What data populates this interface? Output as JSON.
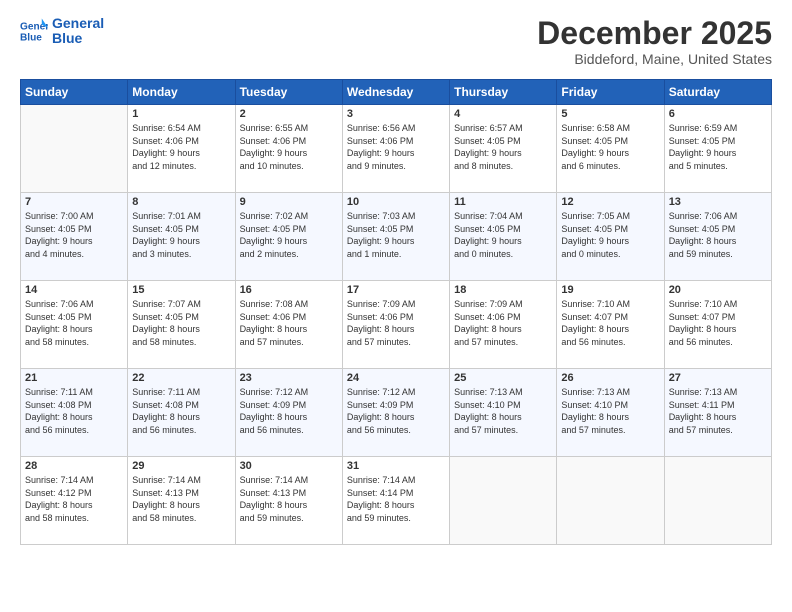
{
  "logo": {
    "line1": "General",
    "line2": "Blue"
  },
  "title": "December 2025",
  "subtitle": "Biddeford, Maine, United States",
  "days_header": [
    "Sunday",
    "Monday",
    "Tuesday",
    "Wednesday",
    "Thursday",
    "Friday",
    "Saturday"
  ],
  "weeks": [
    [
      {
        "day": "",
        "info": ""
      },
      {
        "day": "1",
        "info": "Sunrise: 6:54 AM\nSunset: 4:06 PM\nDaylight: 9 hours\nand 12 minutes."
      },
      {
        "day": "2",
        "info": "Sunrise: 6:55 AM\nSunset: 4:06 PM\nDaylight: 9 hours\nand 10 minutes."
      },
      {
        "day": "3",
        "info": "Sunrise: 6:56 AM\nSunset: 4:06 PM\nDaylight: 9 hours\nand 9 minutes."
      },
      {
        "day": "4",
        "info": "Sunrise: 6:57 AM\nSunset: 4:05 PM\nDaylight: 9 hours\nand 8 minutes."
      },
      {
        "day": "5",
        "info": "Sunrise: 6:58 AM\nSunset: 4:05 PM\nDaylight: 9 hours\nand 6 minutes."
      },
      {
        "day": "6",
        "info": "Sunrise: 6:59 AM\nSunset: 4:05 PM\nDaylight: 9 hours\nand 5 minutes."
      }
    ],
    [
      {
        "day": "7",
        "info": "Sunrise: 7:00 AM\nSunset: 4:05 PM\nDaylight: 9 hours\nand 4 minutes."
      },
      {
        "day": "8",
        "info": "Sunrise: 7:01 AM\nSunset: 4:05 PM\nDaylight: 9 hours\nand 3 minutes."
      },
      {
        "day": "9",
        "info": "Sunrise: 7:02 AM\nSunset: 4:05 PM\nDaylight: 9 hours\nand 2 minutes."
      },
      {
        "day": "10",
        "info": "Sunrise: 7:03 AM\nSunset: 4:05 PM\nDaylight: 9 hours\nand 1 minute."
      },
      {
        "day": "11",
        "info": "Sunrise: 7:04 AM\nSunset: 4:05 PM\nDaylight: 9 hours\nand 0 minutes."
      },
      {
        "day": "12",
        "info": "Sunrise: 7:05 AM\nSunset: 4:05 PM\nDaylight: 9 hours\nand 0 minutes."
      },
      {
        "day": "13",
        "info": "Sunrise: 7:06 AM\nSunset: 4:05 PM\nDaylight: 8 hours\nand 59 minutes."
      }
    ],
    [
      {
        "day": "14",
        "info": "Sunrise: 7:06 AM\nSunset: 4:05 PM\nDaylight: 8 hours\nand 58 minutes."
      },
      {
        "day": "15",
        "info": "Sunrise: 7:07 AM\nSunset: 4:05 PM\nDaylight: 8 hours\nand 58 minutes."
      },
      {
        "day": "16",
        "info": "Sunrise: 7:08 AM\nSunset: 4:06 PM\nDaylight: 8 hours\nand 57 minutes."
      },
      {
        "day": "17",
        "info": "Sunrise: 7:09 AM\nSunset: 4:06 PM\nDaylight: 8 hours\nand 57 minutes."
      },
      {
        "day": "18",
        "info": "Sunrise: 7:09 AM\nSunset: 4:06 PM\nDaylight: 8 hours\nand 57 minutes."
      },
      {
        "day": "19",
        "info": "Sunrise: 7:10 AM\nSunset: 4:07 PM\nDaylight: 8 hours\nand 56 minutes."
      },
      {
        "day": "20",
        "info": "Sunrise: 7:10 AM\nSunset: 4:07 PM\nDaylight: 8 hours\nand 56 minutes."
      }
    ],
    [
      {
        "day": "21",
        "info": "Sunrise: 7:11 AM\nSunset: 4:08 PM\nDaylight: 8 hours\nand 56 minutes."
      },
      {
        "day": "22",
        "info": "Sunrise: 7:11 AM\nSunset: 4:08 PM\nDaylight: 8 hours\nand 56 minutes."
      },
      {
        "day": "23",
        "info": "Sunrise: 7:12 AM\nSunset: 4:09 PM\nDaylight: 8 hours\nand 56 minutes."
      },
      {
        "day": "24",
        "info": "Sunrise: 7:12 AM\nSunset: 4:09 PM\nDaylight: 8 hours\nand 56 minutes."
      },
      {
        "day": "25",
        "info": "Sunrise: 7:13 AM\nSunset: 4:10 PM\nDaylight: 8 hours\nand 57 minutes."
      },
      {
        "day": "26",
        "info": "Sunrise: 7:13 AM\nSunset: 4:10 PM\nDaylight: 8 hours\nand 57 minutes."
      },
      {
        "day": "27",
        "info": "Sunrise: 7:13 AM\nSunset: 4:11 PM\nDaylight: 8 hours\nand 57 minutes."
      }
    ],
    [
      {
        "day": "28",
        "info": "Sunrise: 7:14 AM\nSunset: 4:12 PM\nDaylight: 8 hours\nand 58 minutes."
      },
      {
        "day": "29",
        "info": "Sunrise: 7:14 AM\nSunset: 4:13 PM\nDaylight: 8 hours\nand 58 minutes."
      },
      {
        "day": "30",
        "info": "Sunrise: 7:14 AM\nSunset: 4:13 PM\nDaylight: 8 hours\nand 59 minutes."
      },
      {
        "day": "31",
        "info": "Sunrise: 7:14 AM\nSunset: 4:14 PM\nDaylight: 8 hours\nand 59 minutes."
      },
      {
        "day": "",
        "info": ""
      },
      {
        "day": "",
        "info": ""
      },
      {
        "day": "",
        "info": ""
      }
    ]
  ]
}
